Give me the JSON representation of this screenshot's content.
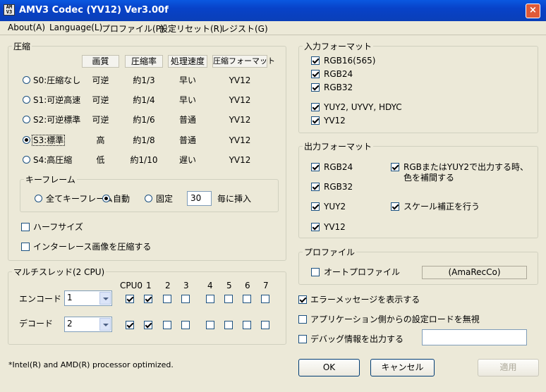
{
  "window": {
    "title": "AMV3 Codec (YV12) Ver3.00f",
    "app_icon_text": "AM V3",
    "close_glyph": "×"
  },
  "menu": [
    "About(A)",
    "Language(L)",
    "プロファイル(P)",
    "設定リセット(R)",
    "レジスト(G)"
  ],
  "compression": {
    "group_label": "圧縮",
    "headers": [
      "画質",
      "圧縮率",
      "処理速度",
      "圧縮フォーマット"
    ],
    "rows": [
      {
        "label": "S0:圧縮なし",
        "quality": "可逆",
        "ratio": "約1/3",
        "speed": "早い",
        "format": "YV12",
        "selected": false
      },
      {
        "label": "S1:可逆高速",
        "quality": "可逆",
        "ratio": "約1/4",
        "speed": "早い",
        "format": "YV12",
        "selected": false
      },
      {
        "label": "S2:可逆標準",
        "quality": "可逆",
        "ratio": "約1/6",
        "speed": "普通",
        "format": "YV12",
        "selected": false
      },
      {
        "label": "S3:標準",
        "quality": "高",
        "ratio": "約1/8",
        "speed": "普通",
        "format": "YV12",
        "selected": true
      },
      {
        "label": "S4:高圧縮",
        "quality": "低",
        "ratio": "約1/10",
        "speed": "遅い",
        "format": "YV12",
        "selected": false
      }
    ],
    "keyframe": {
      "group_label": "キーフレーム",
      "all": "全てキーフレーム",
      "auto": "自動",
      "fixed": "固定",
      "interval": "30",
      "suffix": "毎に挿入",
      "selected": "auto"
    },
    "half_size": {
      "label": "ハーフサイズ",
      "checked": false
    },
    "interlace": {
      "label": "インターレース画像を圧縮する",
      "checked": false
    }
  },
  "multithread": {
    "group_label": "マルチスレッド(2 CPU)",
    "cpu_headers": [
      "CPU0",
      "1",
      "2",
      "3",
      "4",
      "5",
      "6",
      "7"
    ],
    "encode": {
      "label": "エンコード",
      "value": "1",
      "cpus": [
        true,
        true,
        false,
        false,
        false,
        false,
        false,
        false
      ]
    },
    "decode": {
      "label": "デコード",
      "value": "2",
      "cpus": [
        true,
        true,
        false,
        false,
        false,
        false,
        false,
        false
      ]
    }
  },
  "footer_note": "*Intel(R) and AMD(R) processor optimized.",
  "input_format": {
    "group_label": "入力フォーマット",
    "items": [
      {
        "label": "RGB16(565)",
        "checked": true
      },
      {
        "label": "RGB24",
        "checked": true
      },
      {
        "label": "RGB32",
        "checked": true
      },
      {
        "label": "YUY2, UYVY, HDYC",
        "checked": true
      },
      {
        "label": "YV12",
        "checked": true
      }
    ]
  },
  "output_format": {
    "group_label": "出力フォーマット",
    "items": [
      {
        "label": "RGB24",
        "checked": true
      },
      {
        "label": "RGB32",
        "checked": true
      },
      {
        "label": "YUY2",
        "checked": true
      },
      {
        "label": "YV12",
        "checked": true
      }
    ],
    "color_correct": {
      "line1": "RGBまたはYUY2で出力する時、",
      "line2": "色を補間する",
      "checked": true
    },
    "scale_correct": {
      "label": "スケール補正を行う",
      "checked": true
    }
  },
  "profile": {
    "group_label": "プロファイル",
    "auto_profile": {
      "label": "オートプロファイル",
      "checked": false
    },
    "name": "(AmaRecCo)"
  },
  "options": {
    "show_errors": {
      "label": "エラーメッセージを表示する",
      "checked": true
    },
    "ignore_app_load": {
      "label": "アプリケーション側からの設定ロードを無視",
      "checked": false
    },
    "debug_output": {
      "label": "デバッグ情報を出力する",
      "checked": false,
      "path": ""
    }
  },
  "buttons": {
    "ok": "OK",
    "cancel": "キャンセル",
    "apply": "適用"
  }
}
